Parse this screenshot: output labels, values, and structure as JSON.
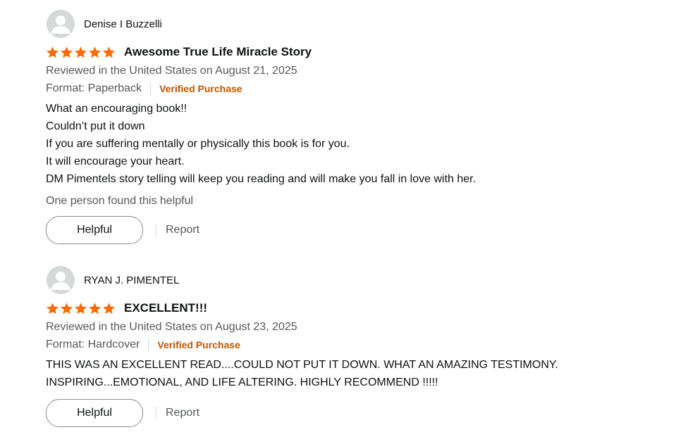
{
  "colors": {
    "star": "#ff6b00",
    "verified": "#c45500",
    "secondary_text": "#565959",
    "avatar_bg": "#d5d9d9"
  },
  "reviews": [
    {
      "reviewer": "Denise I Buzzelli",
      "rating": 5,
      "title": "Awesome True Life Miracle Story",
      "date": "Reviewed in the United States on August 21, 2025",
      "format": "Format: Paperback",
      "verified": "Verified Purchase",
      "body": [
        "What an encouraging book!!",
        "Couldn’t put it down",
        "If you are suffering mentally or physically this book is for you.",
        "It will encourage your heart.",
        "DM Pimentels story telling will keep you reading and will make you fall in love with her."
      ],
      "helpful_count": "One person found this helpful",
      "helpful_label": "Helpful",
      "report_label": "Report"
    },
    {
      "reviewer": "RYAN J. PIMENTEL",
      "rating": 5,
      "title": "EXCELLENT!!!",
      "date": "Reviewed in the United States on August 23, 2025",
      "format": "Format: Hardcover",
      "verified": "Verified Purchase",
      "body": [
        "THIS WAS AN EXCELLENT READ....COULD NOT PUT IT DOWN. WHAT AN AMAZING TESTIMONY.",
        "INSPIRING...EMOTIONAL, AND LIFE ALTERING. HIGHLY RECOMMEND !!!!!"
      ],
      "helpful_label": "Helpful",
      "report_label": "Report"
    }
  ]
}
